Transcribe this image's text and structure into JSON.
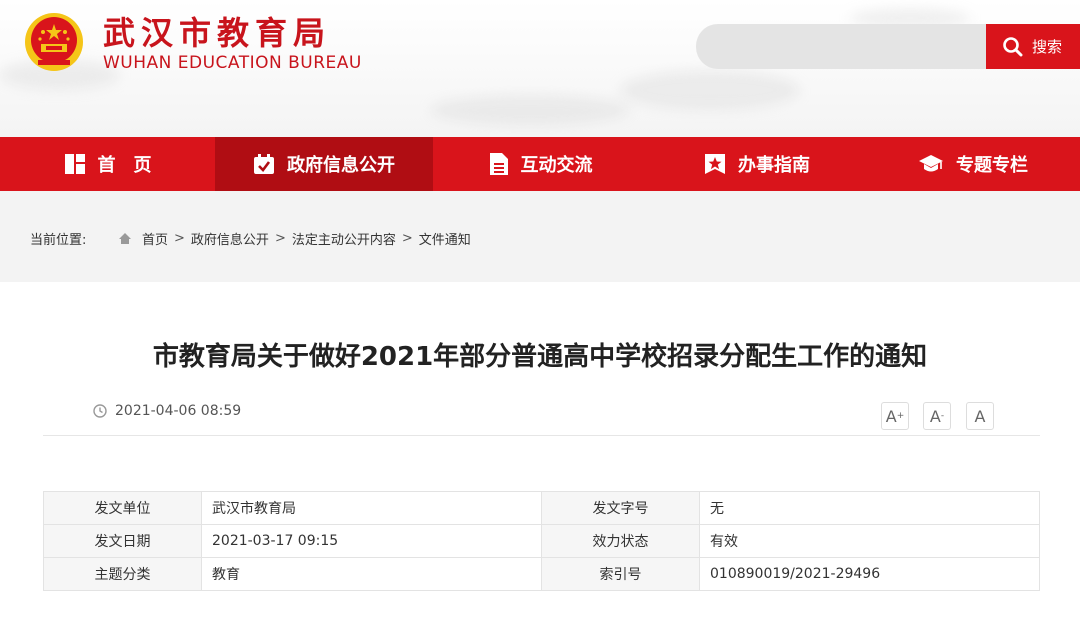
{
  "header": {
    "title": "武汉市教育局",
    "subtitle": "WUHAN EDUCATION BUREAU",
    "search_placeholder": "",
    "search_label": "搜索"
  },
  "nav": [
    {
      "label": "首　页",
      "icon": "home-grid-icon"
    },
    {
      "label": "政府信息公开",
      "icon": "calendar-check-icon"
    },
    {
      "label": "互动交流",
      "icon": "document-icon"
    },
    {
      "label": "办事指南",
      "icon": "star-bookmark-icon"
    },
    {
      "label": "专题专栏",
      "icon": "graduation-cap-icon"
    }
  ],
  "breadcrumb": {
    "label": "当前位置:",
    "items": [
      "首页",
      "政府信息公开",
      "法定主动公开内容",
      "文件通知"
    ],
    "separator": ">"
  },
  "article": {
    "title": "市教育局关于做好2021年部分普通高中学校招录分配生工作的通知",
    "datetime": "2021-04-06 08:59",
    "font_buttons": [
      "A+",
      "A-",
      "A"
    ]
  },
  "info": {
    "rows": [
      {
        "k1": "发文单位",
        "v1": "武汉市教育局",
        "k2": "发文字号",
        "v2": "无"
      },
      {
        "k1": "发文日期",
        "v1": "2021-03-17 09:15",
        "k2": "效力状态",
        "v2": "有效"
      },
      {
        "k1": "主题分类",
        "v1": "教育",
        "k2": "索引号",
        "v2": "010890019/2021-29496"
      }
    ]
  },
  "colors": {
    "brand_red": "#d9141b",
    "nav_active": "#b00d13",
    "emblem_gold": "#f5c518"
  }
}
